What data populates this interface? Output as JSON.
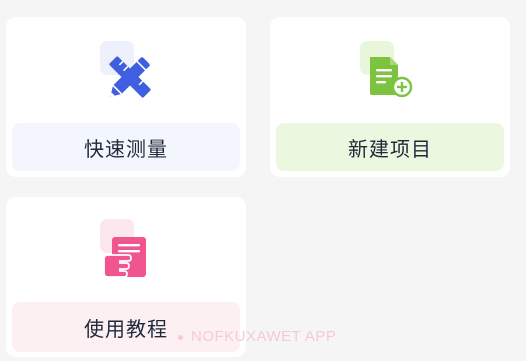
{
  "cards": [
    {
      "label": "快速测量",
      "icon": "ruler-pencil-icon",
      "accent": "#3f5fe0",
      "label_bg": "#f4f6fd"
    },
    {
      "label": "新建项目",
      "icon": "new-document-icon",
      "accent": "#7cc33f",
      "label_bg": "#ebf8df"
    },
    {
      "label": "使用教程",
      "icon": "tutorial-document-icon",
      "accent": "#f15590",
      "label_bg": "#fdf0f3"
    }
  ],
  "watermark": {
    "text": "NOFKUXAWET APP"
  }
}
